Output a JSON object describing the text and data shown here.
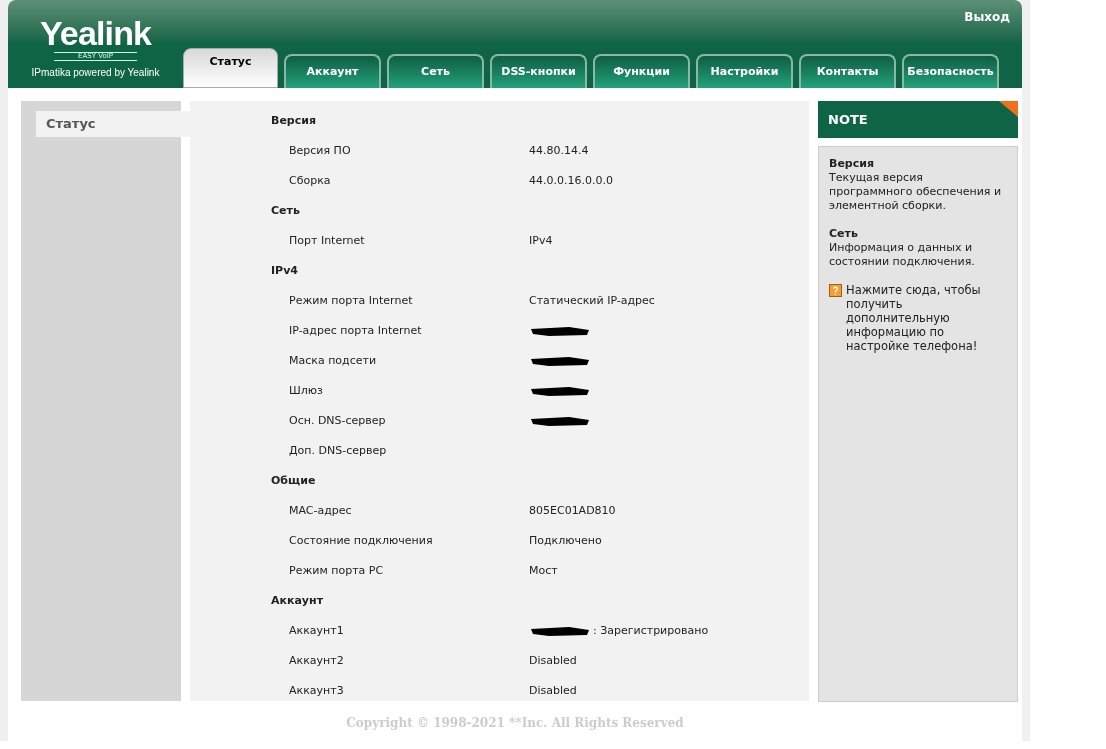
{
  "header": {
    "logo": "Yealink",
    "logo_tagline": "EASY VoIP",
    "subtitle": "IPmatika powered by Yealink",
    "logout": "Выход"
  },
  "tabs": [
    {
      "label": "Статус",
      "selected": true
    },
    {
      "label": "Аккаунт",
      "selected": false
    },
    {
      "label": "Сеть",
      "selected": false
    },
    {
      "label": "DSS-кнопки",
      "selected": false
    },
    {
      "label": "Функции",
      "selected": false
    },
    {
      "label": "Настройки",
      "selected": false
    },
    {
      "label": "Контакты",
      "selected": false
    },
    {
      "label": "Безопасность",
      "selected": false
    }
  ],
  "sidebar": {
    "items": [
      {
        "label": "Статус",
        "selected": true
      }
    ]
  },
  "sections": [
    {
      "title": "Версия",
      "rows": [
        {
          "label": "Версия ПО",
          "value": "44.80.14.4"
        },
        {
          "label": "Сборка",
          "value": "44.0.0.16.0.0.0"
        }
      ]
    },
    {
      "title": "Сеть",
      "rows": [
        {
          "label": "Порт Internet",
          "value": "IPv4"
        }
      ]
    },
    {
      "title": "IPv4",
      "rows": [
        {
          "label": "Режим порта Internet",
          "value": "Статический IP-адрес"
        },
        {
          "label": "IP-адрес порта Internet",
          "redacted": true
        },
        {
          "label": "Маска подсети",
          "redacted": true
        },
        {
          "label": "Шлюз",
          "redacted": true
        },
        {
          "label": "Осн. DNS-сервер",
          "redacted": true
        },
        {
          "label": "Доп. DNS-сервер"
        }
      ]
    },
    {
      "title": "Общие",
      "rows": [
        {
          "label": "MAC-адрес",
          "value": "805EC01AD810"
        },
        {
          "label": "Состояние подключения",
          "value": "Подключено"
        },
        {
          "label": "Режим порта PC",
          "value": "Мост"
        }
      ]
    },
    {
      "title": "Аккаунт",
      "rows": [
        {
          "label": "Аккаунт1",
          "value": ": Зарегистрировано",
          "redacted": true
        },
        {
          "label": "Аккаунт2",
          "value": "Disabled"
        },
        {
          "label": "Аккаунт3",
          "value": "Disabled"
        }
      ]
    }
  ],
  "note": {
    "title": "NOTE",
    "entries": [
      {
        "heading": "Версия",
        "text": "Текущая версия программного обеспечения и элементной сборки."
      },
      {
        "heading": "Сеть",
        "text": "Информация о данных и состоянии подключения."
      }
    ],
    "help": "Нажмите сюда, чтобы получить дополнительную информацию по настройке телефона!"
  },
  "footer": "Copyright © 1998-2021 **Inc. All Rights Reserved"
}
